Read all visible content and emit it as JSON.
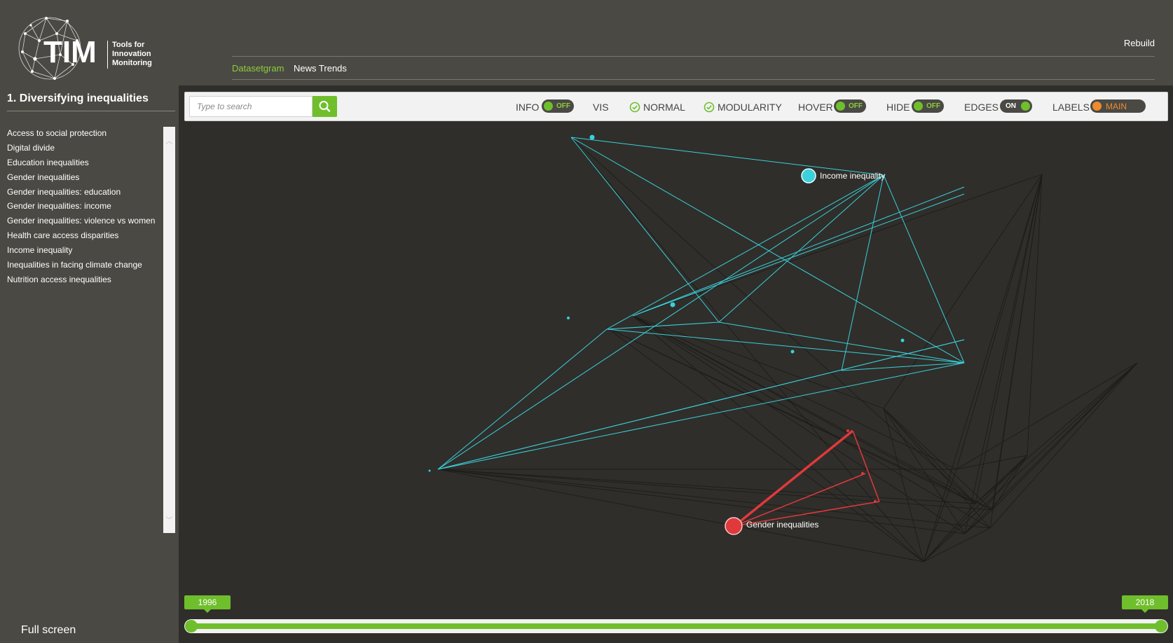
{
  "header": {
    "logo_text": "TIM",
    "logo_tagline": "Tools for\nInnovation\nMonitoring",
    "rebuild_label": "Rebuild",
    "nav": [
      {
        "label": "Datasetgram",
        "active": true
      },
      {
        "label": "News Trends",
        "active": false
      }
    ]
  },
  "sidebar": {
    "title": "1. Diversifying inequalities",
    "items": [
      "Access to social protection",
      "Digital divide",
      "Education inequalities",
      "Gender inequalities",
      "Gender inequalities: education",
      "Gender inequalities: income",
      "Gender inequalities: violence vs women",
      "Health care access disparities",
      "Income inequality",
      "Inequalities in facing climate change",
      "Nutrition access inequalities"
    ],
    "fullscreen_label": "Full screen"
  },
  "toolbar": {
    "search_placeholder": "Type to search",
    "info_label": "INFO",
    "info_state": "OFF",
    "vis_label": "VIS",
    "normal_label": "NORMAL",
    "modularity_label": "MODULARITY",
    "hover_label": "HOVER",
    "hover_state": "OFF",
    "hide_label": "HIDE",
    "hide_state": "OFF",
    "edges_label": "EDGES",
    "edges_state": "ON",
    "labels_label": "LABELS",
    "labels_state": "MAIN"
  },
  "graph": {
    "labels": {
      "income": "Income inequality",
      "gender": "Gender inequalities"
    },
    "colors": {
      "cyan": "#3ad0dc",
      "red": "#e0393b",
      "dark_edge": "#1c1c1a",
      "background": "#2f2e2a"
    }
  },
  "timeline": {
    "start_year": "1996",
    "end_year": "2018"
  },
  "colors": {
    "accent_green": "#6fbf2c",
    "header_bg": "#4a4943",
    "labels_orange": "#f08a2e"
  }
}
